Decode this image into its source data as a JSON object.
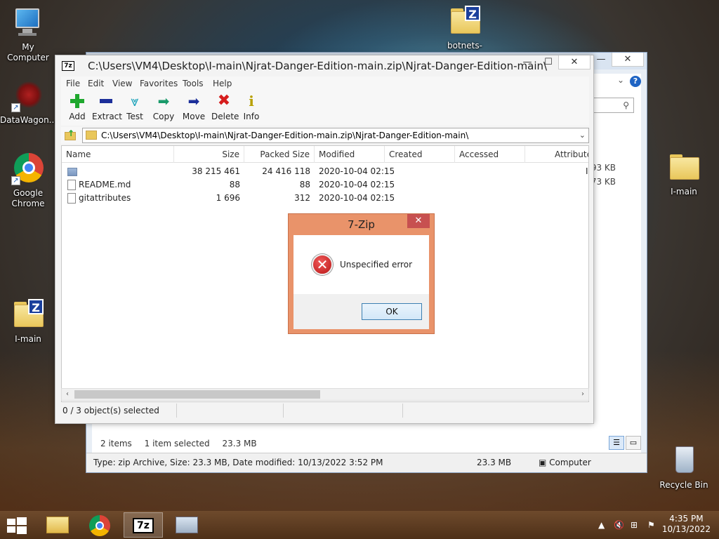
{
  "desktop": {
    "icons": [
      {
        "label": "My Computer"
      },
      {
        "label": "DataWagon..."
      },
      {
        "label": "Google Chrome"
      },
      {
        "label": "I-main"
      },
      {
        "label": "botnets-ma..."
      },
      {
        "label": "I-main"
      },
      {
        "label": "Recycle Bin"
      }
    ]
  },
  "explorer": {
    "title_buttons": {
      "minimize": "—",
      "maximize": "☐",
      "close": "✕"
    },
    "help": "?",
    "chevron": "⌄",
    "search_icon": "⚲",
    "size_peek": [
      "93 KB",
      "73 KB"
    ],
    "status_count": "2 items",
    "status_selected": "1 item selected",
    "status_size": "23.3 MB",
    "bottom_info": "Type: zip Archive, Size: 23.3 MB, Date modified: 10/13/2022 3:52 PM",
    "bottom_size": "23.3 MB",
    "bottom_location": "Computer"
  },
  "zip": {
    "title": "C:\\Users\\VM4\\Desktop\\I-main\\Njrat-Danger-Edition-main.zip\\Njrat-Danger-Edition-main\\",
    "title_buttons": {
      "minimize": "—",
      "maximize": "☐",
      "close": "✕"
    },
    "menu": [
      "File",
      "Edit",
      "View",
      "Favorites",
      "Tools",
      "Help"
    ],
    "toolbar": [
      "Add",
      "Extract",
      "Test",
      "Copy",
      "Move",
      "Delete",
      "Info"
    ],
    "address": "C:\\Users\\VM4\\Desktop\\I-main\\Njrat-Danger-Edition-main.zip\\Njrat-Danger-Edition-main\\",
    "columns": [
      "Name",
      "Size",
      "Packed Size",
      "Modified",
      "Created",
      "Accessed",
      "Attribute"
    ],
    "rows": [
      {
        "name": "",
        "size": "38 215 461",
        "packed": "24 416 118",
        "modified": "2020-10-04 02:15",
        "attr": "I"
      },
      {
        "name": "README.md",
        "size": "88",
        "packed": "88",
        "modified": "2020-10-04 02:15",
        "attr": ""
      },
      {
        "name": "gitattributes",
        "size": "1 696",
        "packed": "312",
        "modified": "2020-10-04 02:15",
        "attr": ""
      }
    ],
    "status": "0 / 3 object(s) selected"
  },
  "dialog": {
    "title": "7-Zip",
    "close": "✕",
    "message": "Unspecified error",
    "ok_label": "OK"
  },
  "taskbar": {
    "time": "4:35 PM",
    "date": "10/13/2022",
    "tray_arrow": "▲"
  },
  "colors": {
    "dialog_frame": "#e9936a",
    "dialog_close": "#c75050",
    "taskbar": "#5a3a20"
  }
}
